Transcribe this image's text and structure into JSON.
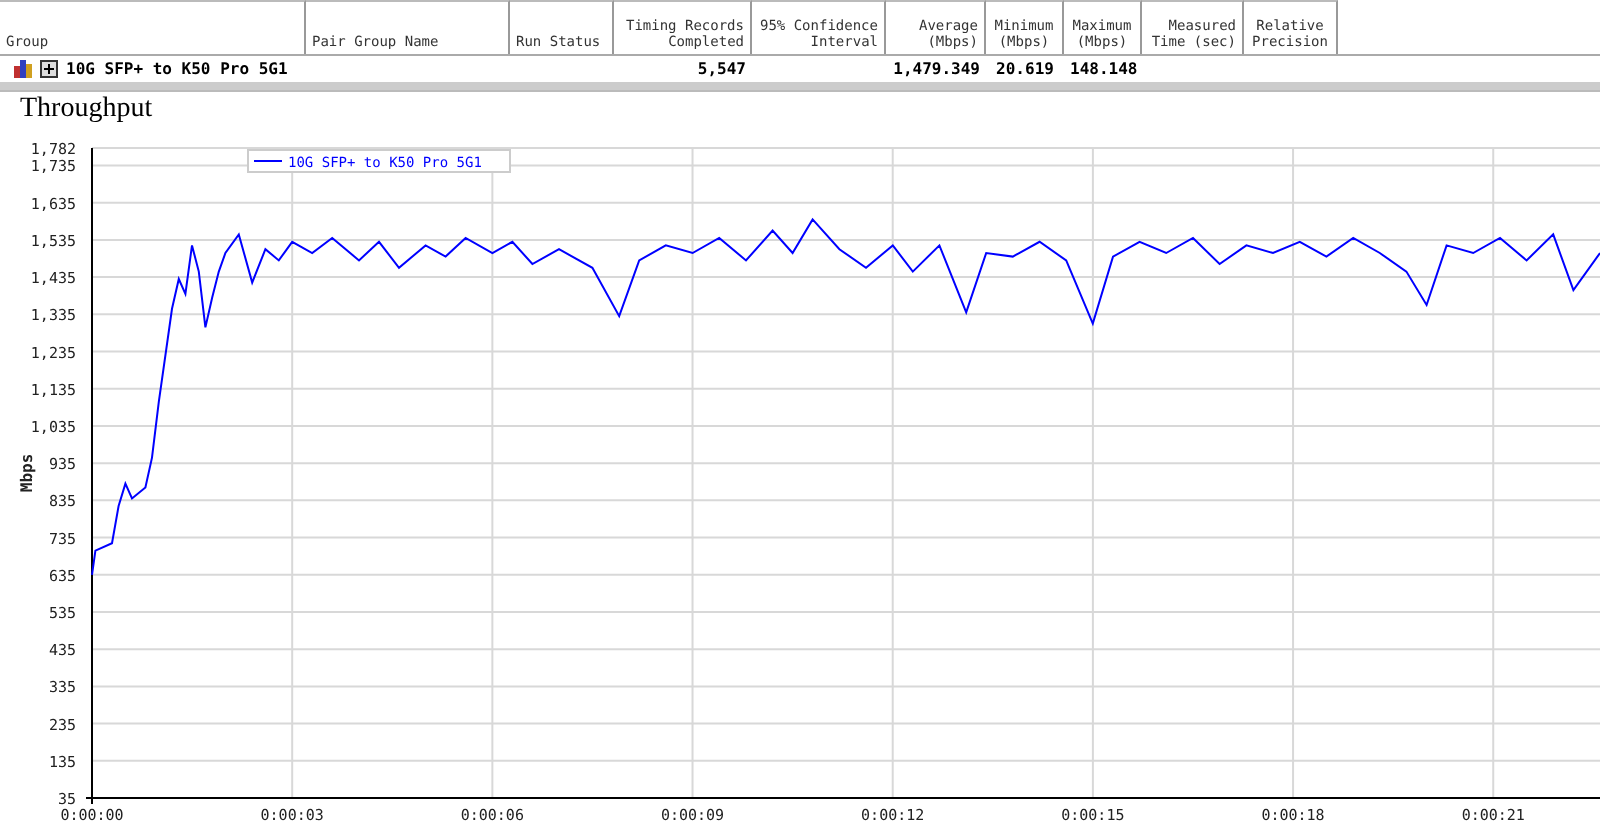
{
  "table": {
    "columns": [
      {
        "label": "Group"
      },
      {
        "label": "Pair Group Name"
      },
      {
        "label": "Run Status"
      },
      {
        "label": "Timing Records Completed"
      },
      {
        "label": "95% Confidence Interval"
      },
      {
        "label": "Average (Mbps)"
      },
      {
        "label": "Minimum (Mbps)"
      },
      {
        "label": "Maximum (Mbps)"
      },
      {
        "label": "Measured Time (sec)"
      },
      {
        "label": "Relative Precision"
      }
    ],
    "rows": [
      {
        "expanded": false,
        "cells": [
          "10G SFP+ to K50 Pro 5G1",
          "",
          "",
          "5,547",
          "",
          "1,479.349",
          "20.619",
          "148.148",
          "",
          ""
        ]
      }
    ]
  },
  "chart": {
    "title": "Throughput",
    "chart_data": {
      "type": "line",
      "grid": true,
      "ylabel": "Mbps",
      "xlim": [
        0,
        22.6
      ],
      "ylim": [
        35,
        1782
      ],
      "xticks": [
        {
          "value": 0,
          "label": "0:00:00"
        },
        {
          "value": 3,
          "label": "0:00:03"
        },
        {
          "value": 6,
          "label": "0:00:06"
        },
        {
          "value": 9,
          "label": "0:00:09"
        },
        {
          "value": 12,
          "label": "0:00:12"
        },
        {
          "value": 15,
          "label": "0:00:15"
        },
        {
          "value": 18,
          "label": "0:00:18"
        },
        {
          "value": 21,
          "label": "0:00:21"
        }
      ],
      "yticks": [
        {
          "value": 35,
          "label": "35"
        },
        {
          "value": 135,
          "label": "135"
        },
        {
          "value": 235,
          "label": "235"
        },
        {
          "value": 335,
          "label": "335"
        },
        {
          "value": 435,
          "label": "435"
        },
        {
          "value": 535,
          "label": "535"
        },
        {
          "value": 635,
          "label": "635"
        },
        {
          "value": 735,
          "label": "735"
        },
        {
          "value": 835,
          "label": "835"
        },
        {
          "value": 935,
          "label": "935"
        },
        {
          "value": 1035,
          "label": "1,035"
        },
        {
          "value": 1135,
          "label": "1,135"
        },
        {
          "value": 1235,
          "label": "1,235"
        },
        {
          "value": 1335,
          "label": "1,335"
        },
        {
          "value": 1435,
          "label": "1,435"
        },
        {
          "value": 1535,
          "label": "1,535"
        },
        {
          "value": 1635,
          "label": "1,635"
        },
        {
          "value": 1735,
          "label": "1,735"
        },
        {
          "value": 1782,
          "label": "1,782"
        }
      ],
      "x": [
        0,
        0.05,
        0.3,
        0.4,
        0.5,
        0.6,
        0.8,
        0.9,
        1.0,
        1.2,
        1.3,
        1.4,
        1.5,
        1.6,
        1.7,
        1.8,
        1.9,
        2.0,
        2.2,
        2.4,
        2.6,
        2.8,
        3.0,
        3.3,
        3.6,
        4.0,
        4.3,
        4.6,
        5.0,
        5.3,
        5.6,
        6.0,
        6.3,
        6.6,
        7.0,
        7.5,
        7.9,
        8.2,
        8.6,
        9.0,
        9.4,
        9.8,
        10.2,
        10.5,
        10.8,
        11.2,
        11.6,
        12.0,
        12.3,
        12.7,
        13.1,
        13.4,
        13.8,
        14.2,
        14.6,
        15.0,
        15.3,
        15.7,
        16.1,
        16.5,
        16.9,
        17.3,
        17.7,
        18.1,
        18.5,
        18.9,
        19.3,
        19.7,
        20.0,
        20.3,
        20.7,
        21.1,
        21.5,
        21.9,
        22.2,
        22.6
      ],
      "series": [
        {
          "name": "10G SFP+ to K50 Pro 5G1",
          "color": "#0000ff",
          "values": [
            635,
            700,
            720,
            820,
            880,
            840,
            870,
            950,
            1100,
            1350,
            1430,
            1390,
            1520,
            1450,
            1300,
            1380,
            1450,
            1500,
            1550,
            1420,
            1510,
            1480,
            1530,
            1500,
            1540,
            1480,
            1530,
            1460,
            1520,
            1490,
            1540,
            1500,
            1530,
            1470,
            1510,
            1460,
            1330,
            1480,
            1520,
            1500,
            1540,
            1480,
            1560,
            1500,
            1590,
            1510,
            1460,
            1520,
            1450,
            1520,
            1340,
            1500,
            1490,
            1530,
            1480,
            1310,
            1490,
            1530,
            1500,
            1540,
            1470,
            1520,
            1500,
            1530,
            1490,
            1540,
            1500,
            1450,
            1360,
            1520,
            1500,
            1540,
            1480,
            1550,
            1400,
            1500
          ]
        }
      ]
    }
  }
}
